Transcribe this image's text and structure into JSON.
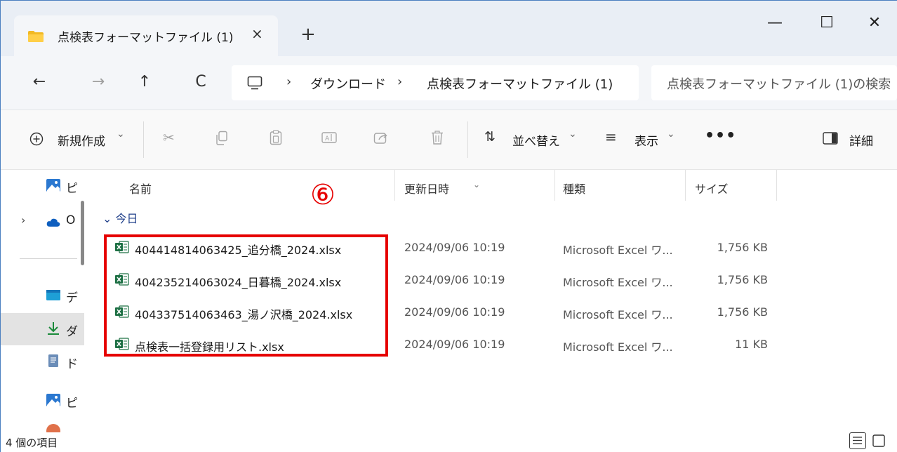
{
  "window": {
    "tab_title": "点検表フォーマットファイル (1)",
    "tab_close": "×",
    "new_tab": "+",
    "minimize": "—",
    "maximize": "☐",
    "close": "✕"
  },
  "nav": {
    "back": "←",
    "forward": "→",
    "up": "↑",
    "refresh": "C",
    "sep": "›",
    "crumbs": [
      "ダウンロード",
      "点検表フォーマットファイル (1)"
    ],
    "search_placeholder": "点検表フォーマットファイル (1)の検索"
  },
  "toolbar": {
    "new_label": "新規作成",
    "sort_label": "並べ替え",
    "view_label": "表示",
    "more_label": "•••",
    "details_label": "詳細",
    "caret": "⌄"
  },
  "sidebar": {
    "items": [
      {
        "icon": "pictures-icon",
        "label": "ピ"
      },
      {
        "icon": "onedrive-icon",
        "label": "O"
      },
      {
        "icon": "desktop-icon",
        "label": "デ"
      },
      {
        "icon": "download-icon",
        "label": "ダ"
      },
      {
        "icon": "document-icon",
        "label": "ド"
      },
      {
        "icon": "pictures-icon",
        "label": "ピ"
      }
    ],
    "expand": "›"
  },
  "columns": {
    "name": "名前",
    "modified": "更新日時",
    "type": "種類",
    "size": "サイズ"
  },
  "group": {
    "label": "今日",
    "chevron": "⌄"
  },
  "files": [
    {
      "name": "404414814063425_追分橋_2024.xlsx",
      "modified": "2024/09/06 10:19",
      "type": "Microsoft Excel ワ...",
      "size": "1,756 KB"
    },
    {
      "name": "404235214063024_日暮橋_2024.xlsx",
      "modified": "2024/09/06 10:19",
      "type": "Microsoft Excel ワ...",
      "size": "1,756 KB"
    },
    {
      "name": "404337514063463_湯ノ沢橋_2024.xlsx",
      "modified": "2024/09/06 10:19",
      "type": "Microsoft Excel ワ...",
      "size": "1,756 KB"
    },
    {
      "name": "点検表一括登録用リスト.xlsx",
      "modified": "2024/09/06 10:19",
      "type": "Microsoft Excel ワ...",
      "size": "11 KB"
    }
  ],
  "annotation": {
    "marker": "⑥",
    "color": "#e60000"
  },
  "status": {
    "item_count": "4 個の項目"
  },
  "colors": {
    "excel_green": "#1d7044",
    "accent": "#0067c0"
  }
}
